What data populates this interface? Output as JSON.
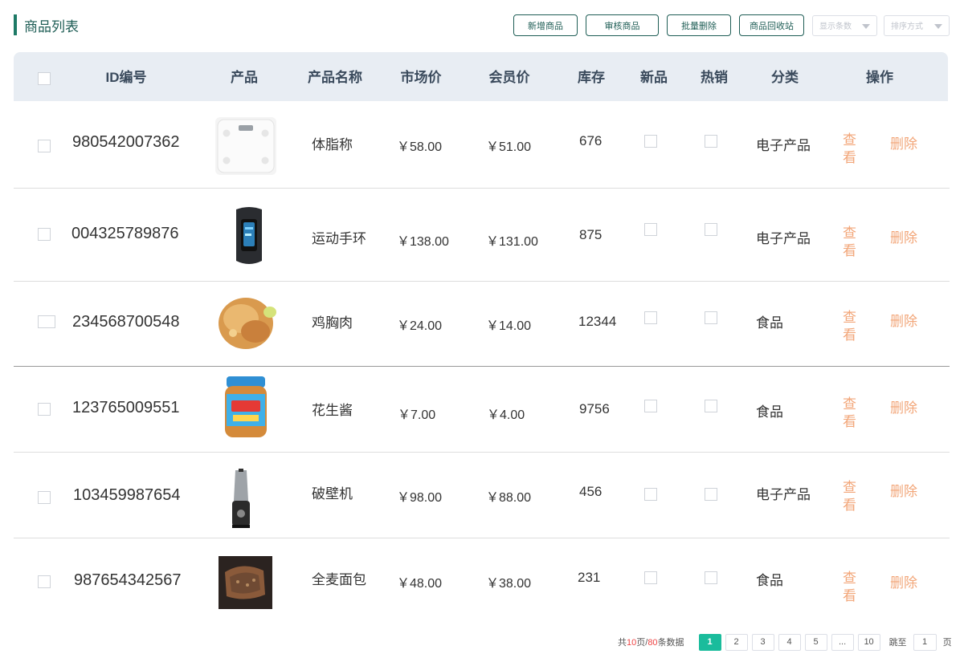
{
  "page": {
    "title": "商品列表"
  },
  "toolbar": {
    "add_label": "新增商品",
    "review_label": "审核商品",
    "batch_delete_label": "批量删除",
    "recycle_label": "商品回收站",
    "page_size_placeholder": "显示条数",
    "sort_placeholder": "排序方式"
  },
  "table": {
    "headers": [
      "ID编号",
      "产品",
      "产品名称",
      "市场价",
      "会员价",
      "库存",
      "新品",
      "热销",
      "分类",
      "操作"
    ],
    "view_label": "查看",
    "delete_label": "删除",
    "rows": [
      {
        "id": "980542007362",
        "image": "body-fat-scale-image",
        "name": "体脂称",
        "market_price": "￥58.00",
        "member_price": "￥51.00",
        "stock": "676",
        "category": "电子产品"
      },
      {
        "id": "004325789876",
        "image": "fitness-band-image",
        "name": "运动手环",
        "market_price": "￥138.00",
        "member_price": "￥131.00",
        "stock": "875",
        "category": "电子产品"
      },
      {
        "id": "234568700548",
        "image": "chicken-breast-image",
        "name": "鸡胸肉",
        "market_price": "￥24.00",
        "member_price": "￥14.00",
        "stock": "12344",
        "category": "食品"
      },
      {
        "id": "123765009551",
        "image": "peanut-butter-image",
        "name": "花生酱",
        "market_price": "￥7.00",
        "member_price": "￥4.00",
        "stock": "9756",
        "category": "食品"
      },
      {
        "id": "103459987654",
        "image": "blender-image",
        "name": "破壁机",
        "market_price": "￥98.00",
        "member_price": "￥88.00",
        "stock": "456",
        "category": "电子产品"
      },
      {
        "id": "987654342567",
        "image": "whole-wheat-bread-image",
        "name": "全麦面包",
        "market_price": "￥48.00",
        "member_price": "￥38.00",
        "stock": "231",
        "category": "食品"
      }
    ]
  },
  "pagination": {
    "total_prefix": "共",
    "total_pages": "10",
    "page_sep": "页/",
    "total_items": "80",
    "total_suffix": "条数据",
    "pages": [
      "1",
      "2",
      "3",
      "4",
      "5",
      "...",
      "10"
    ],
    "current": "1",
    "jump_label": "跳至",
    "jump_value": "1",
    "page_unit": "页"
  },
  "colors": {
    "accent": "#1e5d55",
    "active_page": "#1abc9c",
    "action": "#f2a679",
    "header_bg": "#e8edf3"
  }
}
